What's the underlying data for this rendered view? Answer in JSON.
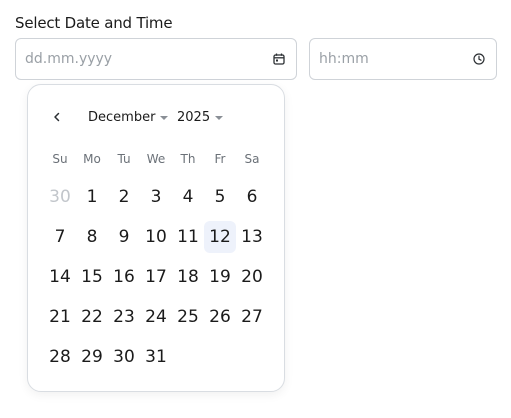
{
  "form": {
    "label": "Select Date and Time"
  },
  "date_input": {
    "placeholder": "dd.mm.yyyy",
    "value": ""
  },
  "time_input": {
    "placeholder": "hh:mm",
    "value": ""
  },
  "calendar": {
    "month": "December",
    "year": "2025",
    "weekdays": [
      "Su",
      "Mo",
      "Tu",
      "We",
      "Th",
      "Fr",
      "Sa"
    ],
    "selected_day": "12",
    "days": [
      {
        "label": "30",
        "outside": true
      },
      {
        "label": "1"
      },
      {
        "label": "2"
      },
      {
        "label": "3"
      },
      {
        "label": "4"
      },
      {
        "label": "5"
      },
      {
        "label": "6"
      },
      {
        "label": "7"
      },
      {
        "label": "8"
      },
      {
        "label": "9"
      },
      {
        "label": "10"
      },
      {
        "label": "11"
      },
      {
        "label": "12",
        "selected": true
      },
      {
        "label": "13"
      },
      {
        "label": "14"
      },
      {
        "label": "15"
      },
      {
        "label": "16"
      },
      {
        "label": "17"
      },
      {
        "label": "18"
      },
      {
        "label": "19"
      },
      {
        "label": "20"
      },
      {
        "label": "21"
      },
      {
        "label": "22"
      },
      {
        "label": "23"
      },
      {
        "label": "24"
      },
      {
        "label": "25"
      },
      {
        "label": "26"
      },
      {
        "label": "27"
      },
      {
        "label": "28"
      },
      {
        "label": "29"
      },
      {
        "label": "30"
      },
      {
        "label": "31"
      }
    ]
  },
  "icons": {
    "date": "calendar-icon",
    "time": "clock-icon",
    "prev": "chevron-left-icon",
    "dropdown": "caret-down-icon"
  },
  "colors": {
    "border": "#cfd3d8",
    "selected_bg": "#eef2fb",
    "muted_text": "#c2c6cb"
  }
}
